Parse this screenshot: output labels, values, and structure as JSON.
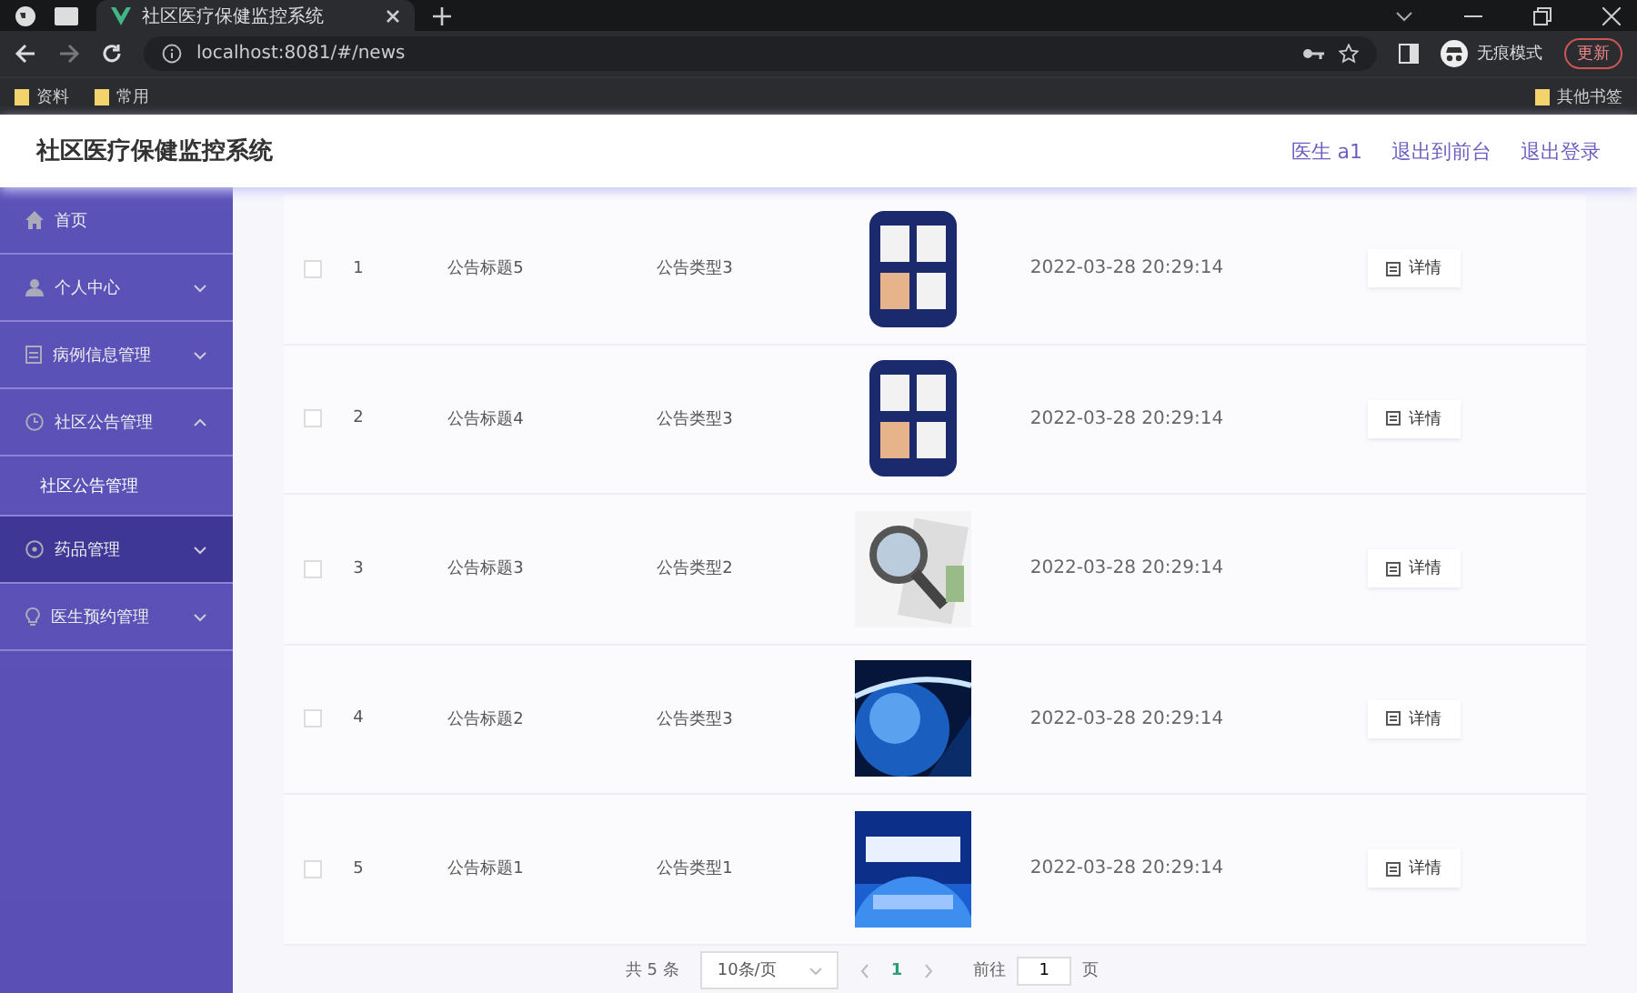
{
  "browser": {
    "tab_title": "社区医疗保健监控系统",
    "url": "localhost:8081/#/news",
    "bookmarks": [
      "资料",
      "常用"
    ],
    "profile_label": "无痕模式",
    "update_label": "更新",
    "other_bookmarks": "其他书签"
  },
  "header": {
    "title": "社区医疗保健监控系统",
    "links": [
      "医生 a1",
      "退出到前台",
      "退出登录"
    ]
  },
  "sidebar": {
    "items": [
      {
        "label": "首页",
        "hovered": false
      },
      {
        "label": "个人中心",
        "hovered": false,
        "expanded": false
      },
      {
        "label": "病例信息管理",
        "hovered": false,
        "expanded": false
      },
      {
        "label": "社区公告管理",
        "hovered": false,
        "expanded": true,
        "children": [
          {
            "label": "社区公告管理"
          }
        ]
      },
      {
        "label": "药品管理",
        "hovered": true,
        "expanded": false
      },
      {
        "label": "医生预约管理",
        "hovered": false,
        "expanded": false
      }
    ]
  },
  "table": {
    "rows": [
      {
        "checked": false,
        "index": "1",
        "title": "公告标题5",
        "type": "公告类型3",
        "date": "2022-03-28 20:29:14",
        "action": "详情"
      },
      {
        "checked": false,
        "index": "2",
        "title": "公告标题4",
        "type": "公告类型3",
        "date": "2022-03-28 20:29:14",
        "action": "详情"
      },
      {
        "checked": false,
        "index": "3",
        "title": "公告标题3",
        "type": "公告类型2",
        "date": "2022-03-28 20:29:14",
        "action": "详情"
      },
      {
        "checked": false,
        "index": "4",
        "title": "公告标题2",
        "type": "公告类型3",
        "date": "2022-03-28 20:29:14",
        "action": "详情"
      },
      {
        "checked": false,
        "index": "5",
        "title": "公告标题1",
        "type": "公告类型1",
        "date": "2022-03-28 20:29:14",
        "action": "详情"
      }
    ]
  },
  "pagination": {
    "total": "共 5 条",
    "page_size": "10条/页",
    "pages": [
      {
        "label": "1",
        "selected": true
      }
    ],
    "goto_label": "前往",
    "goto_value": "1",
    "page_suffix": "页"
  }
}
